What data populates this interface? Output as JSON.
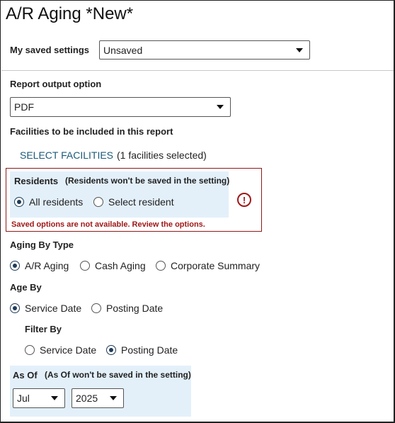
{
  "header": {
    "title": "A/R Aging *New*"
  },
  "saved_settings": {
    "label": "My saved settings",
    "value": "Unsaved"
  },
  "output": {
    "label": "Report output option",
    "value": "PDF"
  },
  "facilities": {
    "label": "Facilities to be included in this report",
    "link": "SELECT FACILITIES",
    "count": "(1 facilities selected)"
  },
  "residents": {
    "label": "Residents",
    "note": "(Residents won't be saved in the setting)",
    "options": [
      "All residents",
      "Select resident"
    ],
    "selected": 0,
    "error": "Saved options are not available. Review the options."
  },
  "aging_type": {
    "label": "Aging By Type",
    "options": [
      "A/R Aging",
      "Cash Aging",
      "Corporate Summary"
    ],
    "selected": 0
  },
  "age_by": {
    "label": "Age By",
    "options": [
      "Service Date",
      "Posting Date"
    ],
    "selected": 0
  },
  "filter_by": {
    "label": "Filter By",
    "options": [
      "Service Date",
      "Posting Date"
    ],
    "selected": 1
  },
  "as_of": {
    "label": "As Of",
    "note": "(As Of won't be saved in the setting)",
    "month": "Jul",
    "year": "2025"
  },
  "colors": {
    "error": "#a01818",
    "highlight": "#e3f0fa",
    "link": "#1a5a7a",
    "radio_selected": "#1f3b57"
  }
}
